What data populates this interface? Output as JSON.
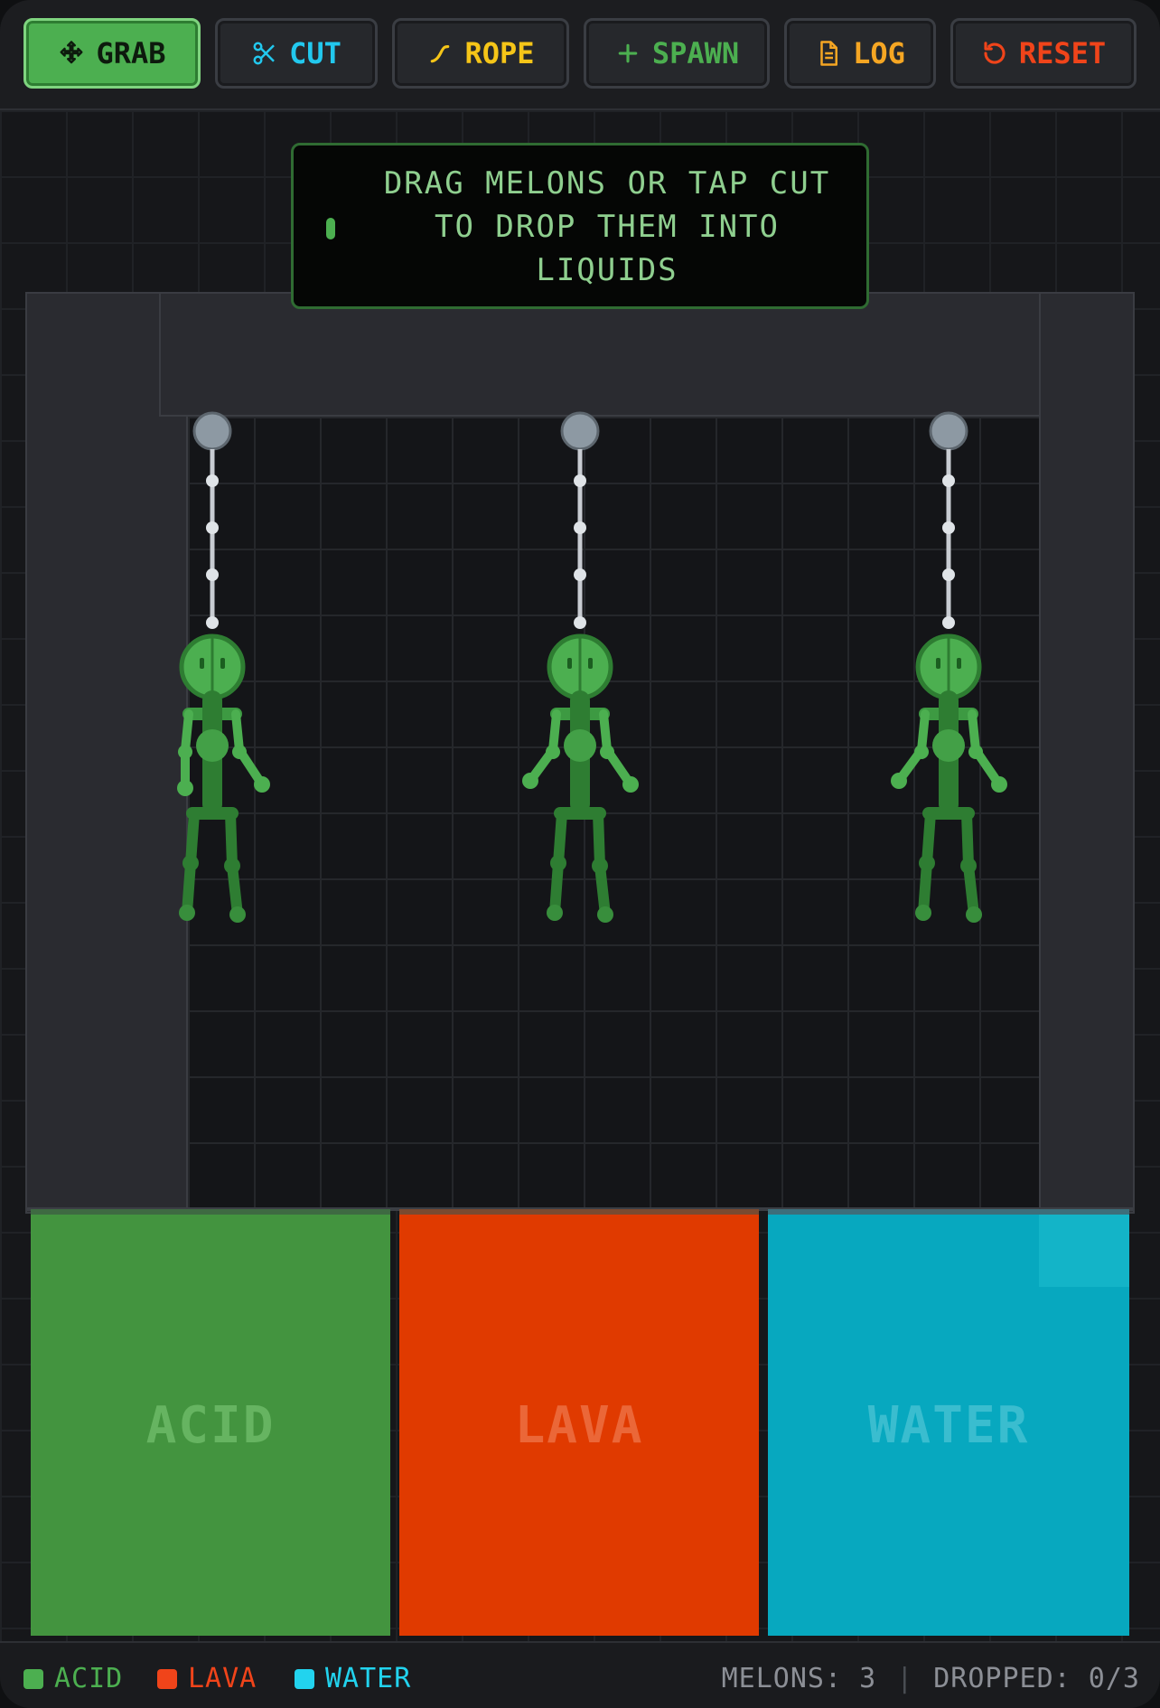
{
  "toolbar": {
    "buttons": [
      {
        "id": "grab",
        "label": "GRAB",
        "icon": "move-icon",
        "color": "#0d1a0d",
        "active": true
      },
      {
        "id": "cut",
        "label": "CUT",
        "icon": "scissors-icon",
        "color": "#22c8ee",
        "active": false
      },
      {
        "id": "rope",
        "label": "ROPE",
        "icon": "rope-icon",
        "color": "#f5c518",
        "active": false
      },
      {
        "id": "spawn",
        "label": "SPAWN",
        "icon": "plus-icon",
        "color": "#4caf50",
        "active": false
      },
      {
        "id": "log",
        "label": "LOG",
        "icon": "document-icon",
        "color": "#f5a623",
        "active": false
      },
      {
        "id": "reset",
        "label": "RESET",
        "icon": "reset-icon",
        "color": "#f0441a",
        "active": false
      }
    ]
  },
  "hint": {
    "text_line1": "DRAG MELONS OR TAP CUT",
    "text_line2": "TO DROP THEM INTO",
    "text_line3": "LIQUIDS"
  },
  "tanks": [
    {
      "id": "acid",
      "label": "ACID",
      "color": "#43943f"
    },
    {
      "id": "lava",
      "label": "LAVA",
      "color": "#e03a00"
    },
    {
      "id": "water",
      "label": "WATER",
      "color": "#07a8bf"
    }
  ],
  "melons": {
    "count": 3,
    "color": "#4caf50",
    "rope_color": "#c8ccd2"
  },
  "status": {
    "legend": [
      {
        "label": "ACID",
        "color": "#4caf50"
      },
      {
        "label": "LAVA",
        "color": "#f0441a"
      },
      {
        "label": "WATER",
        "color": "#22d3ee"
      }
    ],
    "melons_text": "MELONS: 3",
    "separator": "|",
    "dropped_text": "DROPPED: 0/3"
  }
}
